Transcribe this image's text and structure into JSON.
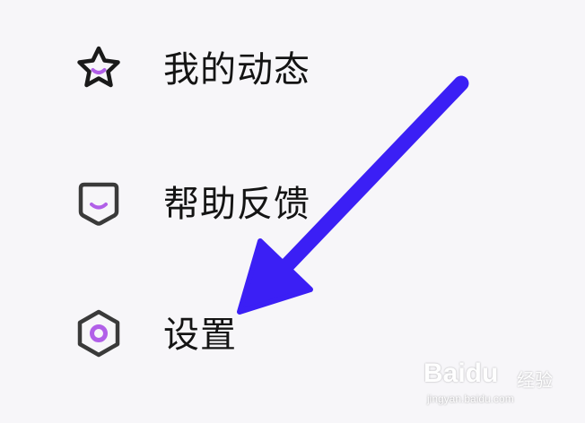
{
  "menu": {
    "items": [
      {
        "label": "我的动态",
        "icon": "star-icon"
      },
      {
        "label": "帮助反馈",
        "icon": "feedback-icon"
      },
      {
        "label": "设置",
        "icon": "settings-hexagon-icon"
      }
    ]
  },
  "annotation": {
    "icon": "arrow-pointer-icon",
    "color": "#3b1ff5",
    "points_to": "设置"
  },
  "watermark": {
    "brand": "Baidu",
    "name": "经验",
    "url": "jingyan.baidu.com"
  },
  "colors": {
    "background": "#f7f6f9",
    "text": "#141414",
    "icon_stroke": "#1a1a1a",
    "accent": "#b15fe8"
  }
}
